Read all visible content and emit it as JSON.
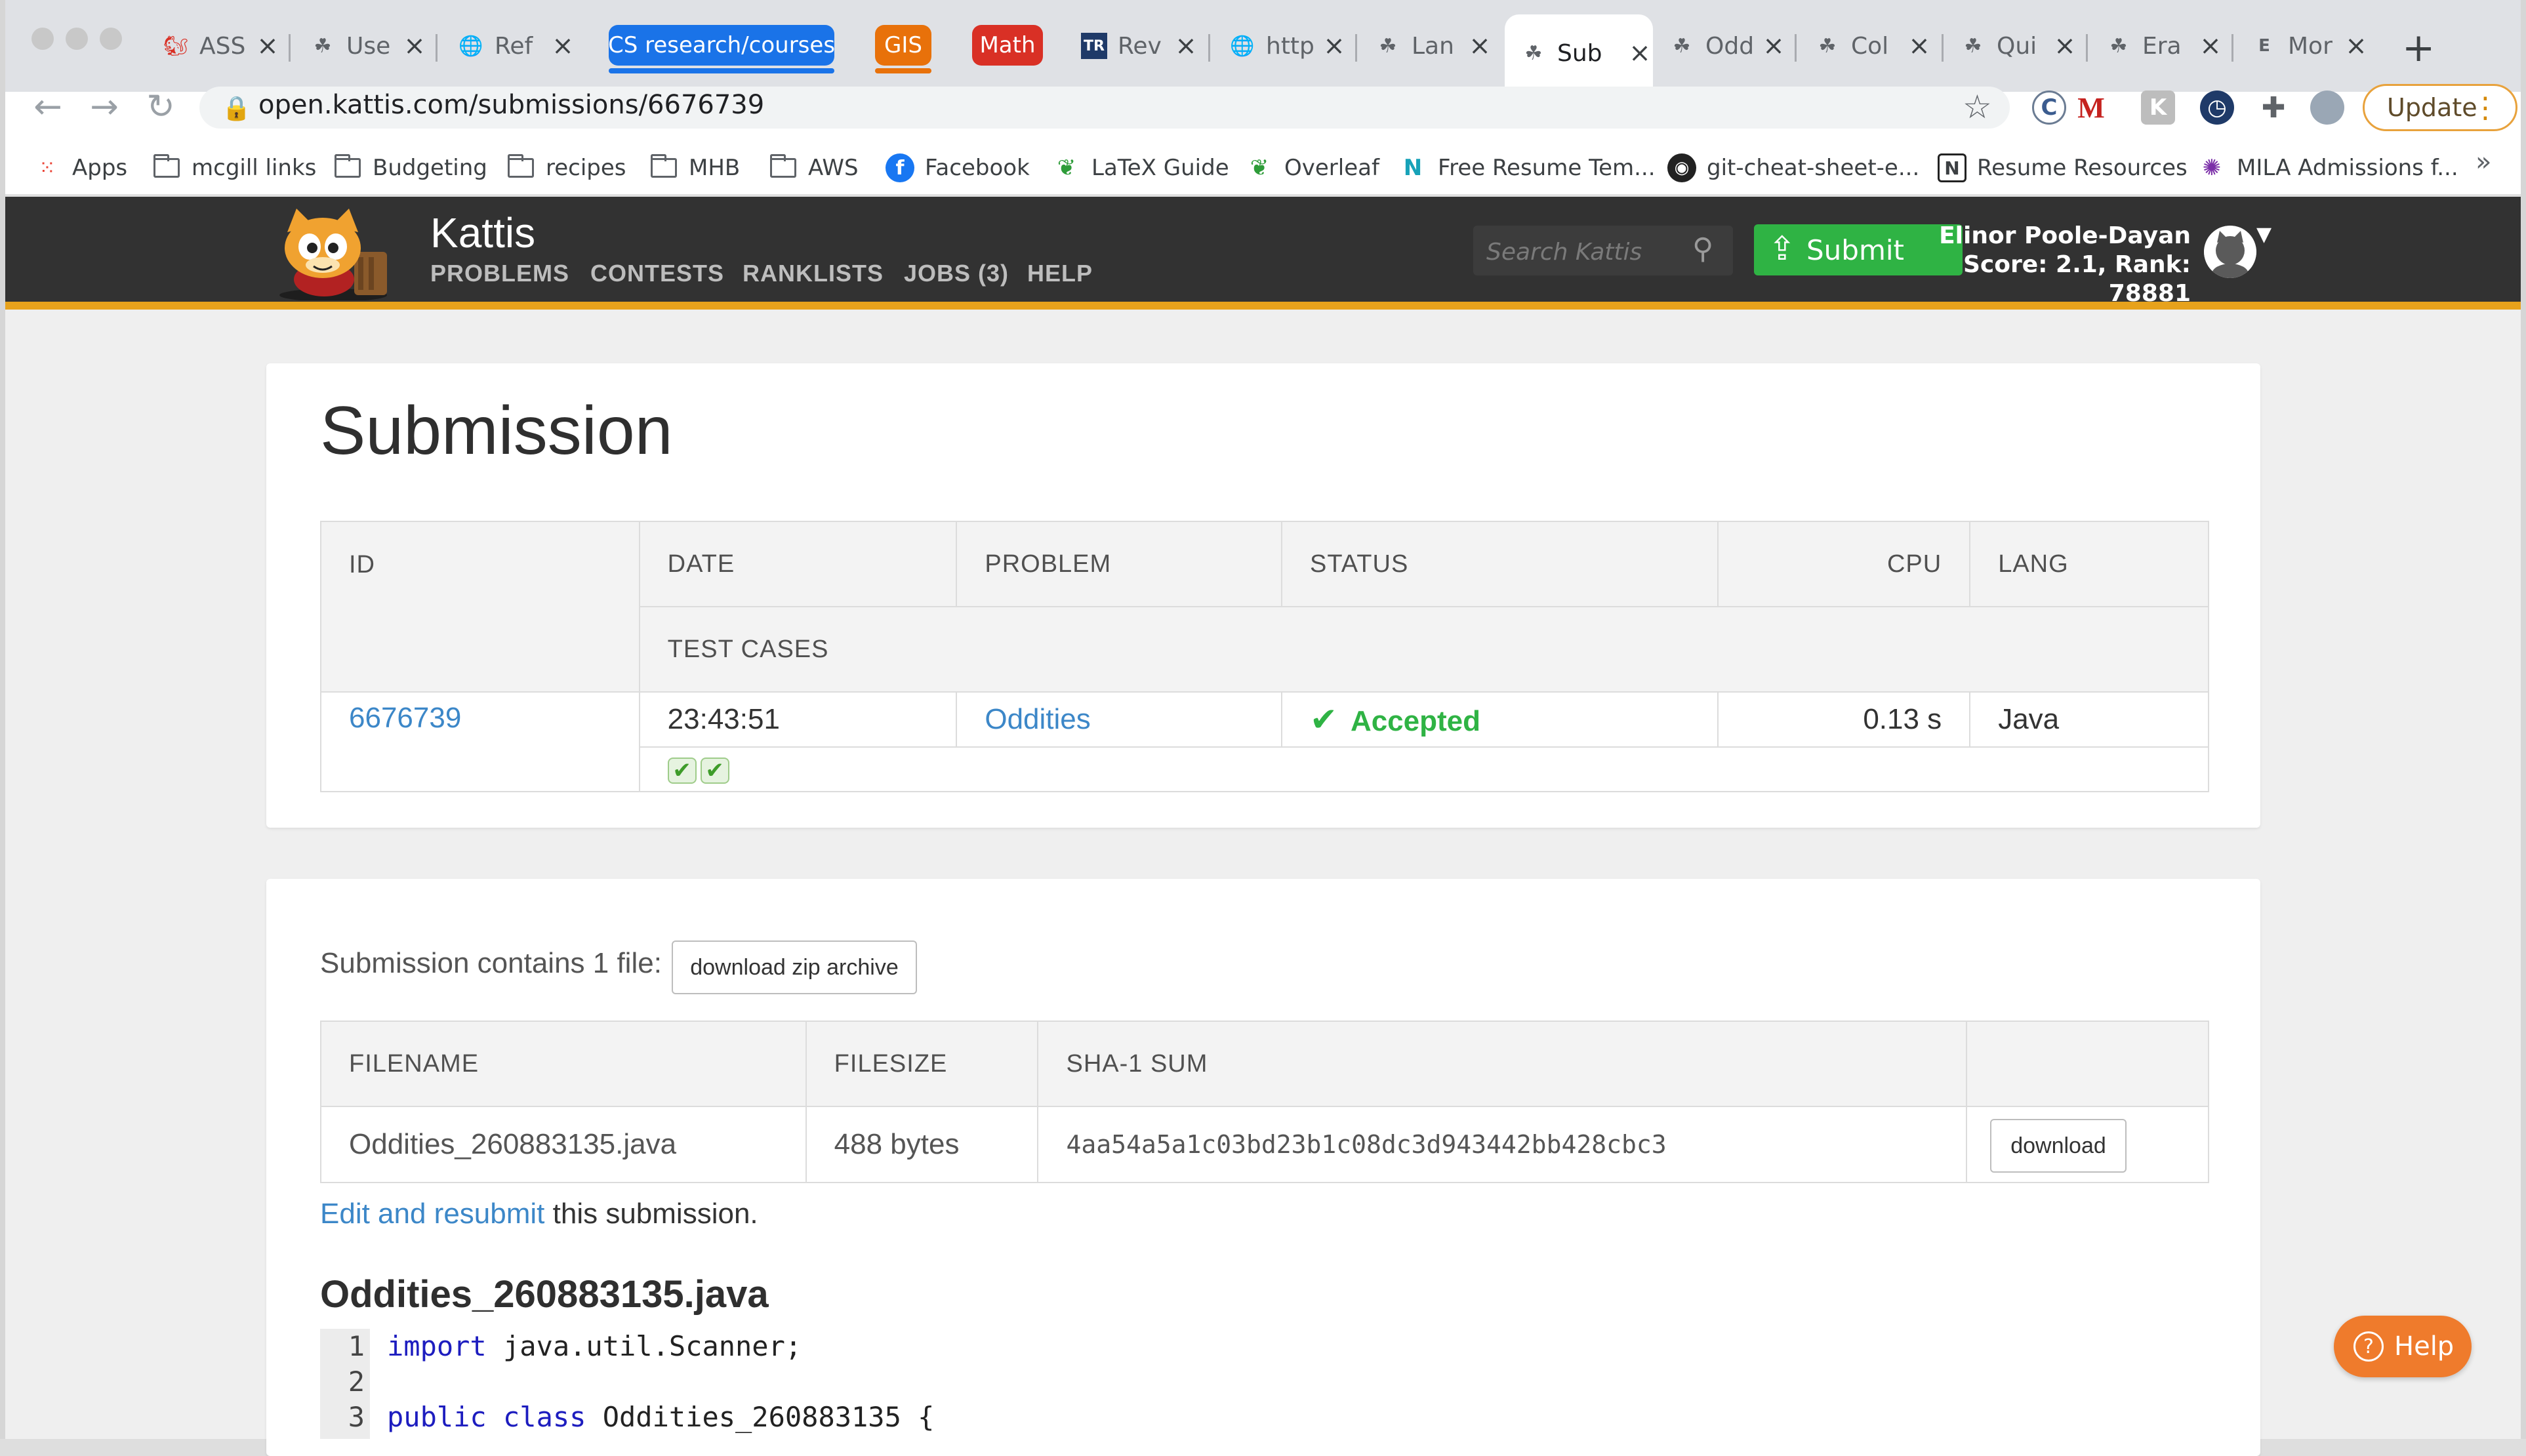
{
  "browser": {
    "tabs": [
      {
        "label": "ASS",
        "icon": "squirrel-icon"
      },
      {
        "label": "Use",
        "icon": "kattis-icon"
      },
      {
        "label": "Ref",
        "icon": "globe-icon"
      },
      {
        "label": "Rev",
        "icon": "tr-icon"
      },
      {
        "label": "http",
        "icon": "globe-icon"
      },
      {
        "label": "Lan",
        "icon": "kattis-icon"
      },
      {
        "label": "Sub",
        "icon": "kattis-icon"
      },
      {
        "label": "Odd",
        "icon": "kattis-icon"
      },
      {
        "label": "Col",
        "icon": "kattis-icon"
      },
      {
        "label": "Qui",
        "icon": "kattis-icon"
      },
      {
        "label": "Era",
        "icon": "kattis-icon"
      },
      {
        "label": "Mor",
        "icon": "doc-icon"
      }
    ],
    "groups": [
      {
        "label": "CS research/courses",
        "color": "#1a73e8"
      },
      {
        "label": "GIS",
        "color": "#e8710a"
      },
      {
        "label": "Math",
        "color": "#d93025"
      }
    ],
    "url": "open.kattis.com/submissions/6676739",
    "update_label": "Update",
    "bookmarks": [
      "Apps",
      "mcgill links",
      "Budgeting",
      "recipes",
      "MHB",
      "AWS",
      "Facebook",
      "LaTeX Guide",
      "Overleaf",
      "Free Resume Tem...",
      "git-cheat-sheet-e...",
      "Resume Resources",
      "MILA Admissions f..."
    ],
    "bookmarks_more": "»"
  },
  "kattis": {
    "title": "Kattis",
    "nav": [
      "PROBLEMS",
      "CONTESTS",
      "RANKLISTS",
      "JOBS (3)",
      "HELP"
    ],
    "search_placeholder": "Search Kattis",
    "submit_label": "Submit",
    "user_name": "Elinor Poole-Dayan",
    "user_stats": "Score: 2.1, Rank: 78881",
    "accent": "#e7a21c"
  },
  "submission": {
    "heading": "Submission",
    "columns": {
      "id": "ID",
      "date": "DATE",
      "problem": "PROBLEM",
      "status": "STATUS",
      "cpu": "CPU",
      "lang": "LANG",
      "test_cases": "TEST CASES"
    },
    "row": {
      "id": "6676739",
      "date": "23:43:51",
      "problem": "Oddities",
      "status": "Accepted",
      "cpu": "0.13 s",
      "lang": "Java"
    },
    "test_case_marks": [
      "✔",
      "✔"
    ],
    "status_color": "#2fb344"
  },
  "files": {
    "contains_text": "Submission contains 1 file:",
    "zip_label": "download zip archive",
    "columns": {
      "filename": "FILENAME",
      "filesize": "FILESIZE",
      "sha": "SHA-1 SUM"
    },
    "row": {
      "filename": "Oddities_260883135.java",
      "filesize": "488 bytes",
      "sha": "4aa54a5a1c03bd23b1c08dc3d943442bb428cbc3",
      "download": "download"
    },
    "edit_link": "Edit and resubmit",
    "edit_suffix": " this submission.",
    "file_heading": "Oddities_260883135.java"
  },
  "code": {
    "lines": [
      {
        "n": "1",
        "kw": "import",
        "rest": " java.util.Scanner;"
      },
      {
        "n": "2",
        "kw": "",
        "rest": ""
      },
      {
        "n": "3",
        "kw": "public class",
        "rest": " Oddities_260883135 {"
      }
    ]
  },
  "help_label": "Help"
}
